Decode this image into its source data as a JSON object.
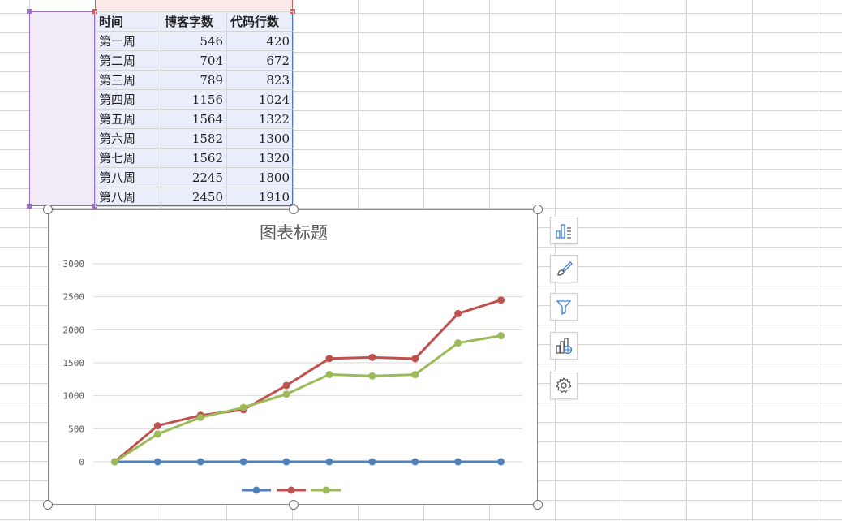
{
  "table": {
    "headers": [
      "时间",
      "博客字数",
      "代码行数"
    ],
    "rows": [
      [
        "第一周",
        "546",
        "420"
      ],
      [
        "第二周",
        "704",
        "672"
      ],
      [
        "第三周",
        "789",
        "823"
      ],
      [
        "第四周",
        "1156",
        "1024"
      ],
      [
        "第五周",
        "1564",
        "1322"
      ],
      [
        "第六周",
        "1582",
        "1300"
      ],
      [
        "第七周",
        "1562",
        "1320"
      ],
      [
        "第八周",
        "2245",
        "1800"
      ],
      [
        "第八周",
        "2450",
        "1910"
      ]
    ]
  },
  "chart_data": {
    "type": "line",
    "title": "图表标题",
    "x": [
      1,
      2,
      3,
      4,
      5,
      6,
      7,
      8,
      9,
      10
    ],
    "yticks": [
      "3000",
      "2500",
      "2000",
      "1500",
      "1000",
      "500",
      "0"
    ],
    "ylim": [
      0,
      3000
    ],
    "grid": true,
    "legend": "bottom",
    "series": [
      {
        "color": "#4f81bd",
        "values": [
          0,
          0,
          0,
          0,
          0,
          0,
          0,
          0,
          0,
          0
        ]
      },
      {
        "color": "#c0504d",
        "values": [
          0,
          546,
          704,
          789,
          1156,
          1564,
          1582,
          1562,
          2245,
          2450
        ]
      },
      {
        "color": "#9bbb59",
        "values": [
          0,
          420,
          672,
          823,
          1024,
          1322,
          1300,
          1320,
          1800,
          1910
        ]
      }
    ]
  },
  "side_toolbar": [
    {
      "icon": "chart-elements-icon"
    },
    {
      "icon": "chart-style-icon"
    },
    {
      "icon": "chart-filter-icon"
    },
    {
      "icon": "chart-type-icon"
    },
    {
      "icon": "chart-settings-icon"
    }
  ]
}
